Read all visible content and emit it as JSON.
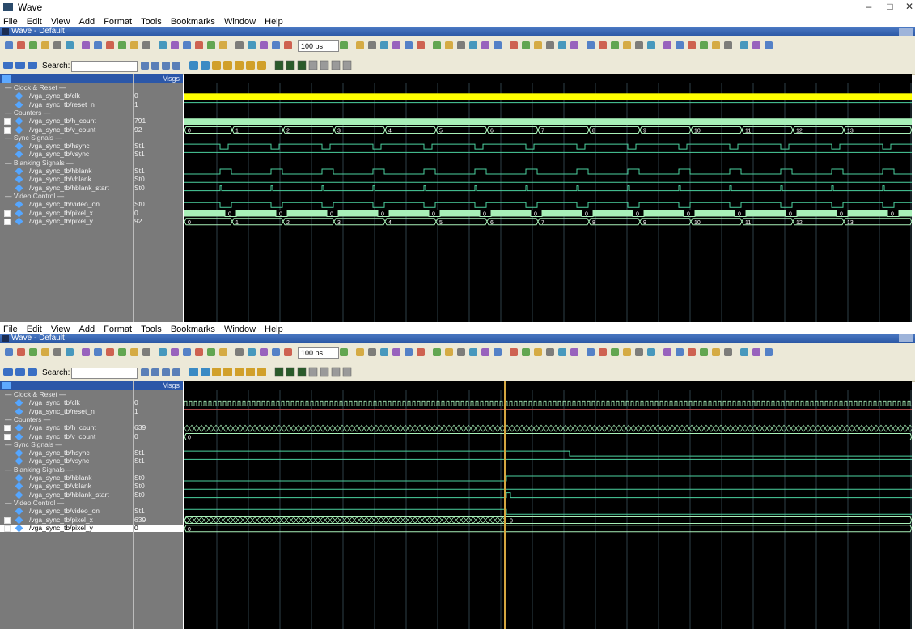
{
  "window": {
    "title": "Wave",
    "controls": [
      "–",
      "□",
      "✕"
    ]
  },
  "menu": [
    "File",
    "Edit",
    "View",
    "Add",
    "Format",
    "Tools",
    "Bookmarks",
    "Window",
    "Help"
  ],
  "pane_title": "Wave - Default",
  "toolbar": {
    "search_label": "Search:",
    "search_value": "",
    "step_value": "100 ps"
  },
  "signals_header": {
    "msgs_label": "Msgs"
  },
  "colors": {
    "clock": "#ffff00",
    "bus": "#a8f0b8",
    "digital": "#4cd2a0",
    "cursor": "#d4a640",
    "grid": "#2e3f47"
  },
  "screens": [
    {
      "rows": [
        {
          "type": "group",
          "name": "Clock & Reset"
        },
        {
          "type": "signal",
          "name": "/vga_sync_tb/clk",
          "value": "0"
        },
        {
          "type": "signal",
          "name": "/vga_sync_tb/reset_n",
          "value": "1"
        },
        {
          "type": "group",
          "name": "Counters"
        },
        {
          "type": "bus",
          "name": "/vga_sync_tb/h_count",
          "value": "791"
        },
        {
          "type": "bus",
          "name": "/vga_sync_tb/v_count",
          "value": "92"
        },
        {
          "type": "group",
          "name": "Sync Signals"
        },
        {
          "type": "signal",
          "name": "/vga_sync_tb/hsync",
          "value": "St1"
        },
        {
          "type": "signal",
          "name": "/vga_sync_tb/vsync",
          "value": "St1"
        },
        {
          "type": "group",
          "name": "Blanking Signals"
        },
        {
          "type": "signal",
          "name": "/vga_sync_tb/hblank",
          "value": "St1"
        },
        {
          "type": "signal",
          "name": "/vga_sync_tb/vblank",
          "value": "St0"
        },
        {
          "type": "signal",
          "name": "/vga_sync_tb/hblank_start",
          "value": "St0"
        },
        {
          "type": "group",
          "name": "Video Control"
        },
        {
          "type": "signal",
          "name": "/vga_sync_tb/video_on",
          "value": "St0"
        },
        {
          "type": "bus",
          "name": "/vga_sync_tb/pixel_x",
          "value": "0"
        },
        {
          "type": "bus",
          "name": "/vga_sync_tb/pixel_y",
          "value": "92"
        }
      ],
      "vcount_labels": [
        "0",
        "1",
        "2",
        "3",
        "4",
        "5",
        "6",
        "7",
        "8",
        "9",
        "10",
        "11",
        "12",
        "13"
      ],
      "pixelx_label": "0"
    },
    {
      "rows": [
        {
          "type": "group",
          "name": "Clock & Reset"
        },
        {
          "type": "signal",
          "name": "/vga_sync_tb/clk",
          "value": "0"
        },
        {
          "type": "signal",
          "name": "/vga_sync_tb/reset_n",
          "value": "1"
        },
        {
          "type": "group",
          "name": "Counters"
        },
        {
          "type": "bus",
          "name": "/vga_sync_tb/h_count",
          "value": "639"
        },
        {
          "type": "bus",
          "name": "/vga_sync_tb/v_count",
          "value": "0"
        },
        {
          "type": "group",
          "name": "Sync Signals"
        },
        {
          "type": "signal",
          "name": "/vga_sync_tb/hsync",
          "value": "St1"
        },
        {
          "type": "signal",
          "name": "/vga_sync_tb/vsync",
          "value": "St1"
        },
        {
          "type": "group",
          "name": "Blanking Signals"
        },
        {
          "type": "signal",
          "name": "/vga_sync_tb/hblank",
          "value": "St0"
        },
        {
          "type": "signal",
          "name": "/vga_sync_tb/vblank",
          "value": "St0"
        },
        {
          "type": "signal",
          "name": "/vga_sync_tb/hblank_start",
          "value": "St0"
        },
        {
          "type": "group",
          "name": "Video Control"
        },
        {
          "type": "signal",
          "name": "/vga_sync_tb/video_on",
          "value": "St1"
        },
        {
          "type": "bus",
          "name": "/vga_sync_tb/pixel_x",
          "value": "639"
        },
        {
          "type": "bus",
          "name": "/vga_sync_tb/pixel_y",
          "value": "0"
        }
      ],
      "vcount_label": "0",
      "pixelx_after_label": "0",
      "pixely_label": "0"
    }
  ]
}
